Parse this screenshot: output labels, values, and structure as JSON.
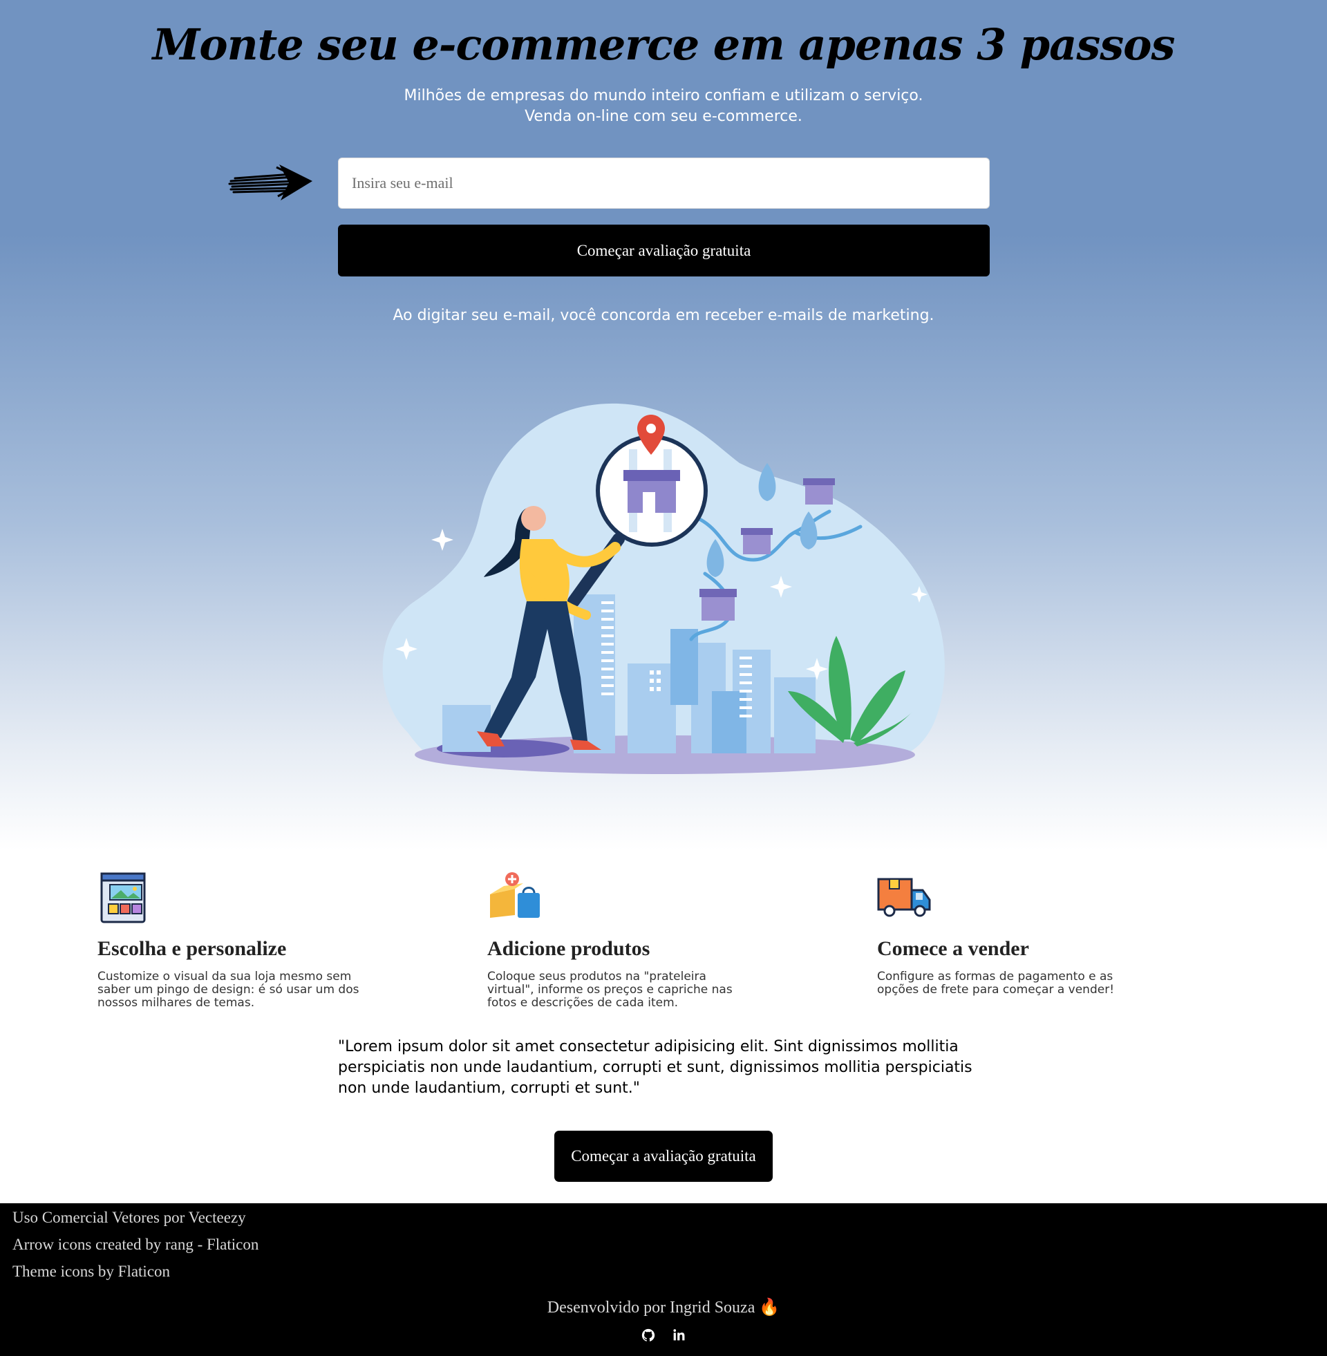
{
  "hero": {
    "title": "Monte seu e-commerce em apenas 3 passos",
    "subtitle_line1": "Milhões de empresas do mundo inteiro confiam e utilizam o serviço.",
    "subtitle_line2": "Venda on-line com seu e-commerce.",
    "email_placeholder": "Insira seu e-mail",
    "cta_label": "Começar avaliação gratuita",
    "consent": "Ao digitar seu e-mail, você concorda em receber e-mails de marketing.",
    "arrow_icon": "arrow-right-icon",
    "illustration": "ecommerce-map-illustration"
  },
  "features": [
    {
      "icon": "website-theme-icon",
      "title": "Escolha e personalize",
      "text": "Customize o visual da sua loja mesmo sem saber um pingo de design: é só usar um dos nossos milhares de temas."
    },
    {
      "icon": "add-product-box-icon",
      "title": "Adicione produtos",
      "text": "Coloque seus produtos na \"prateleira virtual\", informe os preços e capriche nas fotos e descrições de cada item."
    },
    {
      "icon": "delivery-truck-icon",
      "title": "Comece a vender",
      "text": "Configure as formas de pagamento e as opções de frete para começar a vender!"
    }
  ],
  "testimonial": {
    "quote": "\"Lorem ipsum dolor sit amet consectetur adipisicing elit. Sint dignissimos mollitia perspiciatis non unde laudantium, corrupti et sunt, dignissimos mollitia perspiciatis non unde laudantium, corrupti et sunt.\"",
    "cta_label": "Começar a avaliação gratuita"
  },
  "footer": {
    "credits": [
      "Uso Comercial Vetores por Vecteezy",
      "Arrow icons created by rang - Flaticon",
      "Theme icons by Flaticon"
    ],
    "developer": "Desenvolvido por Ingrid Souza 🔥",
    "social_icons": [
      "github-icon",
      "linkedin-icon"
    ]
  },
  "colors": {
    "hero_top": "#7193c1",
    "button_bg": "#000000",
    "footer_bg": "#000000"
  }
}
